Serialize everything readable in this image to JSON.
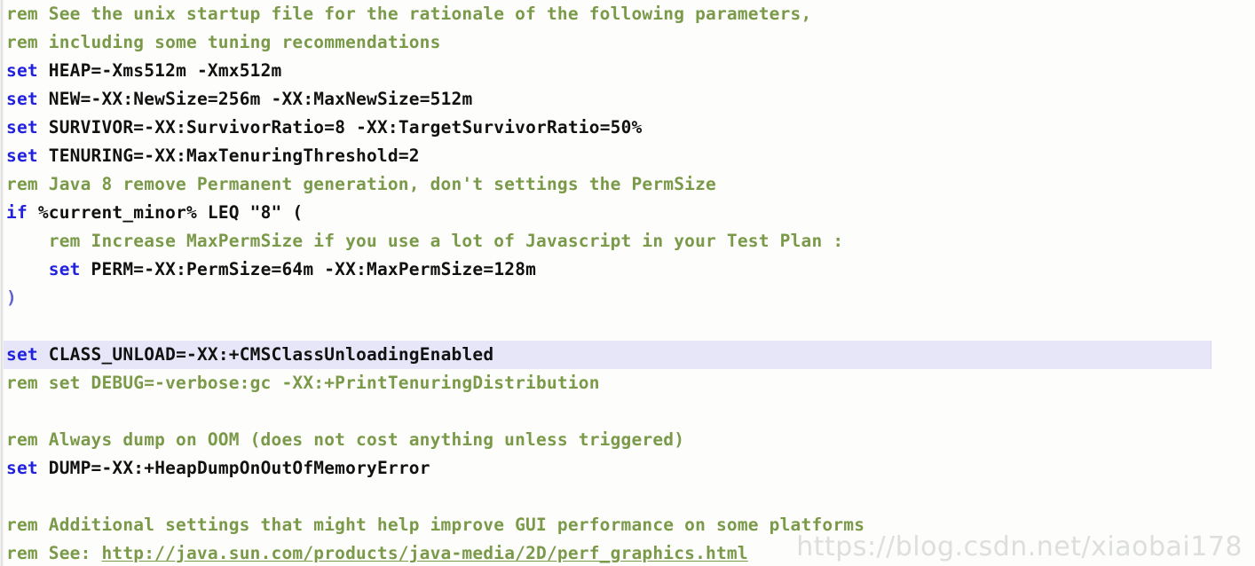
{
  "editor": {
    "language": "bat",
    "background_color": "#fdfdfb",
    "highlighted_line_color": "#e6e6f8",
    "highlighted_line_index": 12,
    "colors": {
      "comment": "#7a9a4a",
      "keyword": "#2222dd",
      "operator": "#e02a2a",
      "variable": "#e09a40",
      "plain": "#111111",
      "paren": "#5b63d6",
      "link": "#7a9a4a"
    }
  },
  "watermark": {
    "text": "https://blog.csdn.net/xiaobai178"
  },
  "lines": [
    {
      "index": 0,
      "tokens": [
        {
          "type": "comment",
          "text": "rem See the unix startup file for the rationale of the following parameters,"
        }
      ]
    },
    {
      "index": 1,
      "tokens": [
        {
          "type": "comment",
          "text": "rem including some tuning recommendations"
        }
      ]
    },
    {
      "index": 2,
      "tokens": [
        {
          "type": "keyword",
          "text": "set"
        },
        {
          "type": "plain",
          "text": " HEAP"
        },
        {
          "type": "operator",
          "text": "="
        },
        {
          "type": "plain",
          "text": "-Xms512m -Xmx512m"
        }
      ]
    },
    {
      "index": 3,
      "tokens": [
        {
          "type": "keyword",
          "text": "set"
        },
        {
          "type": "plain",
          "text": " NEW"
        },
        {
          "type": "operator",
          "text": "="
        },
        {
          "type": "plain",
          "text": "-XX:NewSize"
        },
        {
          "type": "operator",
          "text": "="
        },
        {
          "type": "plain",
          "text": "256m -XX:MaxNewSize"
        },
        {
          "type": "operator",
          "text": "="
        },
        {
          "type": "plain",
          "text": "512m"
        }
      ]
    },
    {
      "index": 4,
      "tokens": [
        {
          "type": "keyword",
          "text": "set"
        },
        {
          "type": "plain",
          "text": " SURVIVOR"
        },
        {
          "type": "operator",
          "text": "="
        },
        {
          "type": "plain",
          "text": "-XX:SurvivorRatio"
        },
        {
          "type": "operator",
          "text": "="
        },
        {
          "type": "plain",
          "text": "8 -XX:TargetSurvivorRatio"
        },
        {
          "type": "operator",
          "text": "="
        },
        {
          "type": "plain",
          "text": "50%"
        }
      ]
    },
    {
      "index": 5,
      "tokens": [
        {
          "type": "keyword",
          "text": "set"
        },
        {
          "type": "plain",
          "text": " TENURING"
        },
        {
          "type": "operator",
          "text": "="
        },
        {
          "type": "plain",
          "text": "-XX:MaxTenuringThreshold"
        },
        {
          "type": "operator",
          "text": "="
        },
        {
          "type": "plain",
          "text": "2"
        }
      ]
    },
    {
      "index": 6,
      "tokens": [
        {
          "type": "comment",
          "text": "rem Java 8 remove Permanent generation, don't settings the PermSize"
        }
      ]
    },
    {
      "index": 7,
      "tokens": [
        {
          "type": "keyword",
          "text": "if"
        },
        {
          "type": "plain",
          "text": " "
        },
        {
          "type": "variable",
          "text": "%current_minor%"
        },
        {
          "type": "plain",
          "text": " LEQ \"8\" ("
        }
      ]
    },
    {
      "index": 8,
      "tokens": [
        {
          "type": "plain",
          "text": "    "
        },
        {
          "type": "comment",
          "text": "rem Increase MaxPermSize if you use a lot of Javascript in your Test Plan :"
        }
      ]
    },
    {
      "index": 9,
      "tokens": [
        {
          "type": "plain",
          "text": "    "
        },
        {
          "type": "keyword",
          "text": "set"
        },
        {
          "type": "plain",
          "text": " PERM"
        },
        {
          "type": "operator",
          "text": "="
        },
        {
          "type": "plain",
          "text": "-XX:PermSize"
        },
        {
          "type": "operator",
          "text": "="
        },
        {
          "type": "plain",
          "text": "64m -XX:MaxPermSize"
        },
        {
          "type": "operator",
          "text": "="
        },
        {
          "type": "plain",
          "text": "128m"
        }
      ]
    },
    {
      "index": 10,
      "tokens": [
        {
          "type": "paren",
          "text": ")"
        }
      ]
    },
    {
      "index": 11,
      "tokens": []
    },
    {
      "index": 12,
      "tokens": [
        {
          "type": "keyword",
          "text": "set"
        },
        {
          "type": "plain",
          "text": " CLASS_UNLOAD"
        },
        {
          "type": "operator",
          "text": "="
        },
        {
          "type": "plain",
          "text": "-XX:"
        },
        {
          "type": "operator",
          "text": "+"
        },
        {
          "type": "plain",
          "text": "CMSClassUnloadingEnabled"
        }
      ]
    },
    {
      "index": 13,
      "tokens": [
        {
          "type": "comment",
          "text": "rem set DEBUG=-verbose:gc -XX:+PrintTenuringDistribution"
        }
      ]
    },
    {
      "index": 14,
      "tokens": []
    },
    {
      "index": 15,
      "tokens": [
        {
          "type": "comment",
          "text": "rem Always dump on OOM (does not cost anything unless triggered)"
        }
      ]
    },
    {
      "index": 16,
      "tokens": [
        {
          "type": "keyword",
          "text": "set"
        },
        {
          "type": "plain",
          "text": " DUMP"
        },
        {
          "type": "operator",
          "text": "="
        },
        {
          "type": "plain",
          "text": "-XX:"
        },
        {
          "type": "operator",
          "text": "+"
        },
        {
          "type": "plain",
          "text": "HeapDumpOnOutOfMemoryError"
        }
      ]
    },
    {
      "index": 17,
      "tokens": []
    },
    {
      "index": 18,
      "tokens": [
        {
          "type": "comment",
          "text": "rem Additional settings that might help improve GUI performance on some platforms"
        }
      ]
    },
    {
      "index": 19,
      "tokens": [
        {
          "type": "comment",
          "text": "rem See: "
        },
        {
          "type": "link",
          "text": "http://java.sun.com/products/java-media/2D/perf_graphics.html"
        }
      ]
    }
  ]
}
